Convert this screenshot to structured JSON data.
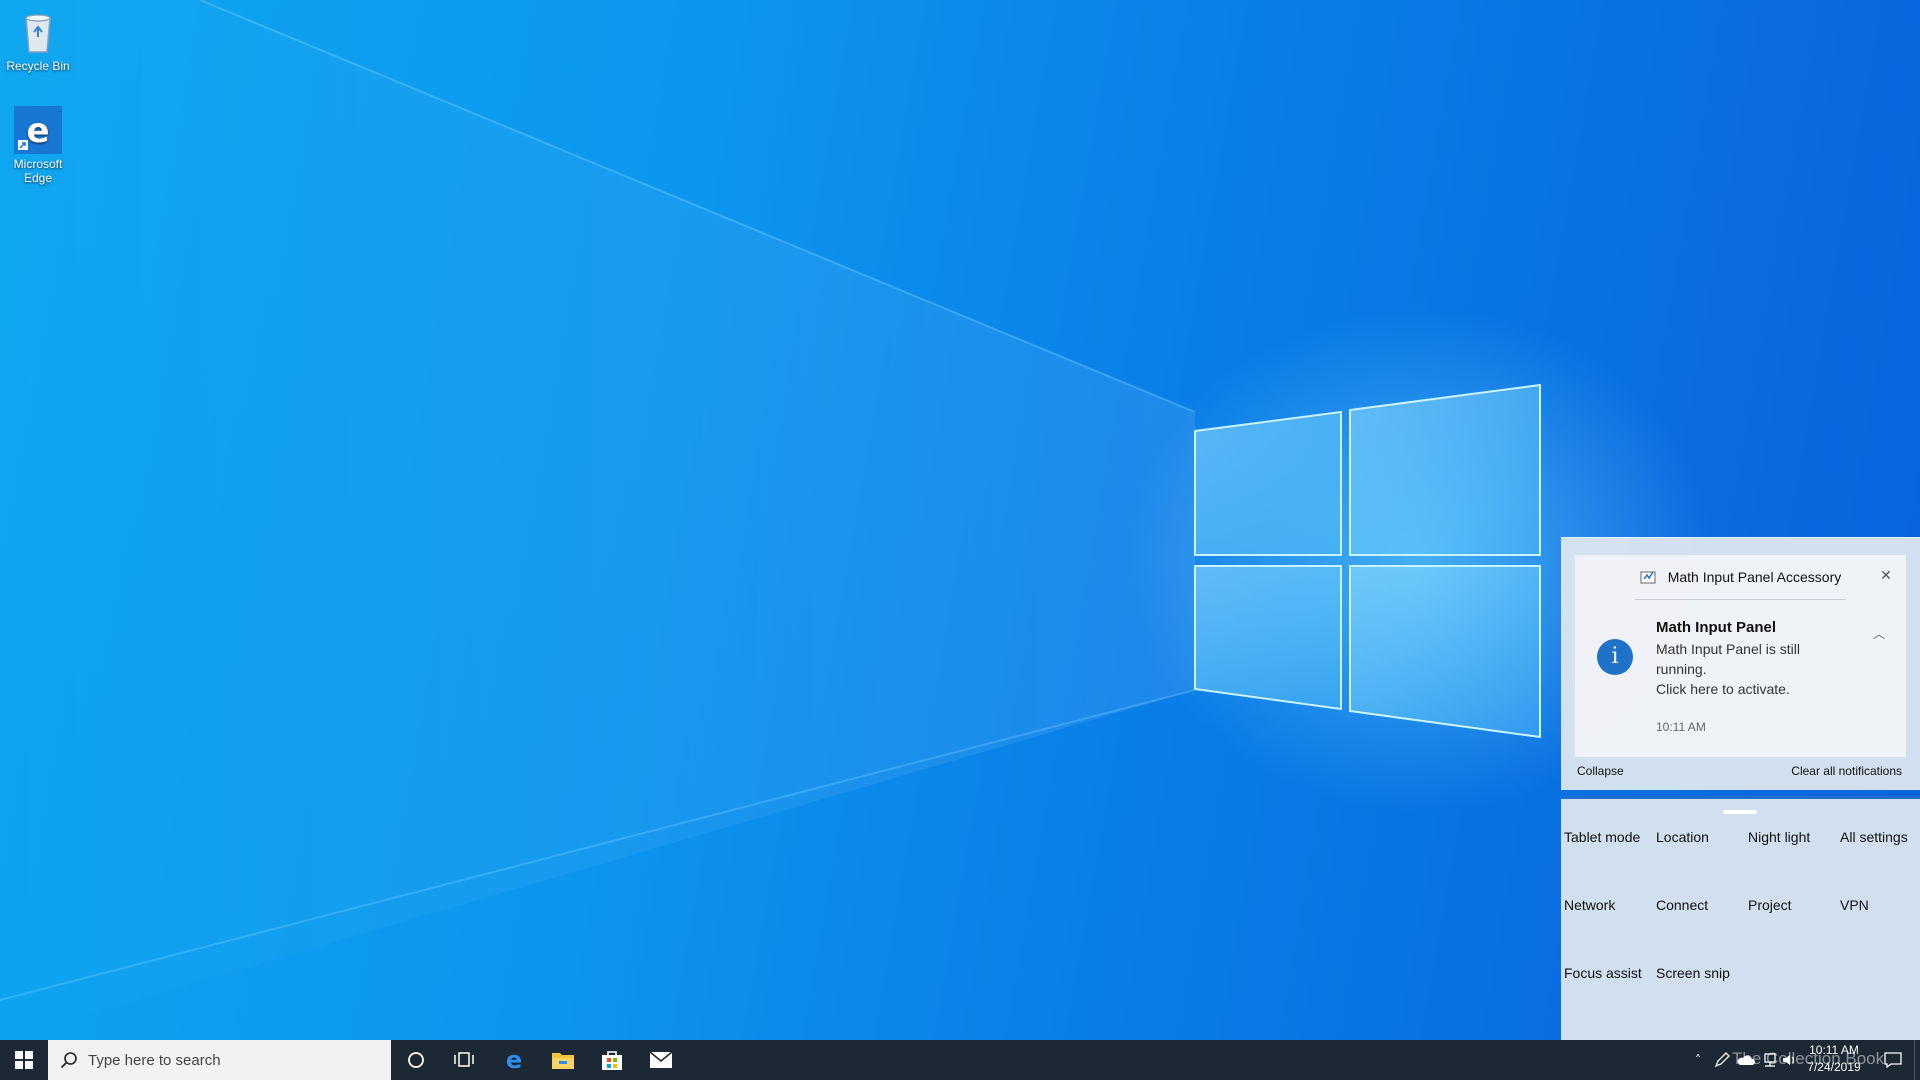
{
  "desktop": {
    "icons": [
      {
        "label": "Recycle Bin",
        "icon": "recycle-bin-icon"
      },
      {
        "label": "Microsoft Edge",
        "icon": "edge-icon"
      }
    ]
  },
  "action_center": {
    "notification": {
      "app_name": "Math Input Panel Accessory",
      "title": "Math Input Panel",
      "body_line1": "Math Input Panel is still",
      "body_line2": "running.",
      "body_line3": "Click here to activate.",
      "time": "10:11 AM"
    },
    "collapse_label": "Collapse",
    "clear_label": "Clear all notifications",
    "quick_actions": [
      "Tablet mode",
      "Location",
      "Night light",
      "All settings",
      "Network",
      "Connect",
      "Project",
      "VPN",
      "Focus assist",
      "Screen snip"
    ]
  },
  "taskbar": {
    "search_placeholder": "Type here to search",
    "pinned": [
      "cortana-icon",
      "task-view-icon",
      "edge-icon",
      "file-explorer-icon",
      "store-icon",
      "mail-icon"
    ],
    "clock_time": "10:11 AM",
    "clock_date": "7/24/2019",
    "watermark": "The Collection Book"
  },
  "colors": {
    "accent": "#1f6fd1",
    "taskbar": "#1c2834",
    "info_icon": "#1e73c8"
  }
}
